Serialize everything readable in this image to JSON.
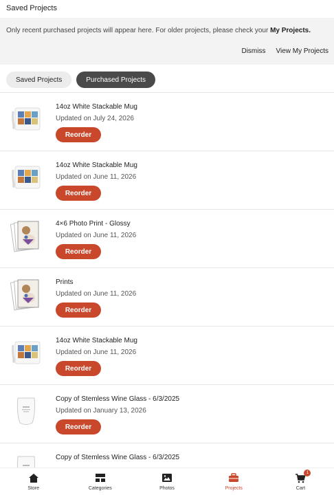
{
  "header": {
    "title": "Saved Projects"
  },
  "notice": {
    "text": "Only recent purchased projects will appear here. For older projects, please check your ",
    "link": "My Projects.",
    "dismiss": "Dismiss",
    "view": "View My Projects"
  },
  "tabs": [
    {
      "label": "Saved Projects",
      "active": false
    },
    {
      "label": "Purchased Projects",
      "active": true
    }
  ],
  "projects": [
    {
      "title": "14oz White Stackable Mug",
      "updated": "Updated on July 24, 2026",
      "button": "Reorder",
      "thumb": "mug"
    },
    {
      "title": "14oz White Stackable Mug",
      "updated": "Updated on June 11, 2026",
      "button": "Reorder",
      "thumb": "mug"
    },
    {
      "title": "4×6 Photo Print - Glossy",
      "updated": "Updated on June 11, 2026",
      "button": "Reorder",
      "thumb": "prints"
    },
    {
      "title": "Prints",
      "updated": "Updated on June 11, 2026",
      "button": "Reorder",
      "thumb": "prints"
    },
    {
      "title": "14oz White Stackable Mug",
      "updated": "Updated on June 11, 2026",
      "button": "Reorder",
      "thumb": "mug"
    },
    {
      "title": "Copy of Stemless Wine Glass - 6/3/2025",
      "updated": "Updated on January 13, 2026",
      "button": "Reorder",
      "thumb": "glass"
    },
    {
      "title": "Copy of Stemless Wine Glass - 6/3/2025",
      "updated": "",
      "button": "",
      "thumb": "glass"
    }
  ],
  "nav": {
    "items": [
      {
        "label": "Store",
        "icon": "home-icon"
      },
      {
        "label": "Categories",
        "icon": "categories-icon"
      },
      {
        "label": "Photos",
        "icon": "photos-icon"
      },
      {
        "label": "Projects",
        "icon": "projects-icon",
        "current": true
      },
      {
        "label": "Cart",
        "icon": "cart-icon",
        "badge": "1"
      }
    ]
  },
  "colors": {
    "accent": "#c9472b",
    "active_tab": "#4a4a4a",
    "notice_bg": "#f3f3f3"
  }
}
